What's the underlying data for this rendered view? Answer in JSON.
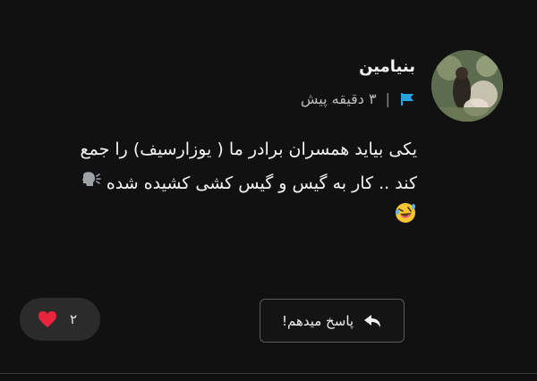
{
  "comment": {
    "author": "بنیامین",
    "time_ago": "۳ دقیقه پیش",
    "separator": "|",
    "message_lines": [
      "یکی بیاید همسران برادر ما ( یوزارسیف) را جمع",
      "کند .. کار به گیس و گیس کشی کشیده شده"
    ],
    "icons": {
      "flag": "flag-icon",
      "speaking": "speaking-head-icon",
      "laughing": "rolling-laughing-emoji",
      "reply": "reply-arrow-icon",
      "heart": "heart-icon"
    }
  },
  "actions": {
    "reply_label": "پاسخ میدهم!",
    "like_count": "۲"
  },
  "colors": {
    "background": "#111111",
    "flag": "#29a3e0",
    "heart": "#e8253c",
    "pill": "#2b2b2b",
    "button_border": "#5a5a5a"
  }
}
